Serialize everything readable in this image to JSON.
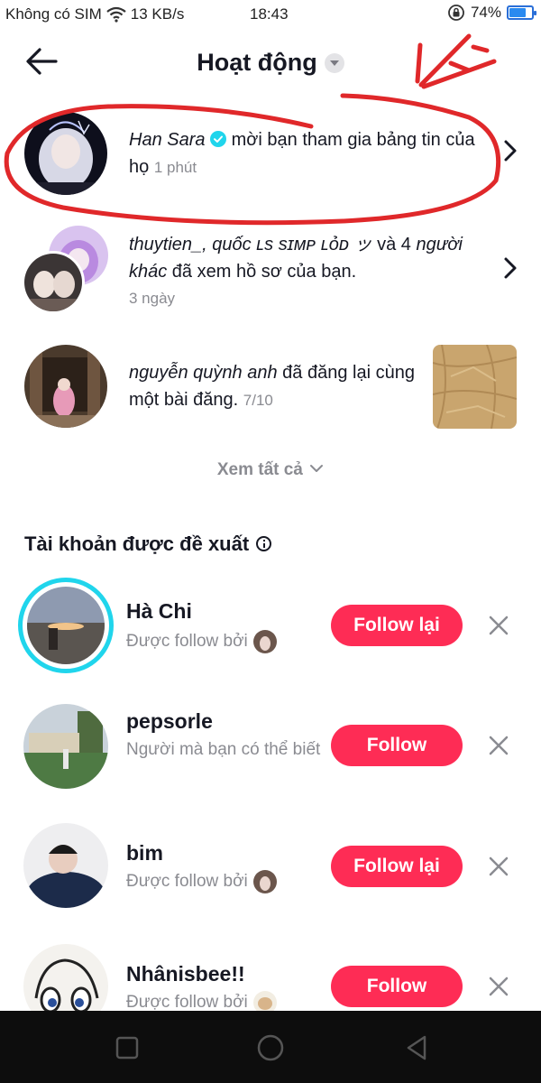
{
  "status_bar": {
    "carrier": "Không có SIM",
    "speed": "13 KB/s",
    "time": "18:43",
    "battery": "74%",
    "battery_level": 0.74
  },
  "header": {
    "title": "Hoạt động"
  },
  "activities": [
    {
      "name": "Han Sara",
      "text": " mời bạn tham gia bảng tin của họ",
      "time": "1 phút",
      "verified": true
    },
    {
      "name": "thuytien_, quốc ʟs sɪᴍᴘ ʟỏᴅ ッ",
      "text_mid": " và 4 ",
      "name2": "người khác",
      "text": " đã xem hồ sơ của bạn.",
      "time": "3 ngày"
    },
    {
      "name": "nguyễn quỳnh anh",
      "text": " đã đăng lại cùng một bài đăng.",
      "time": "7/10"
    }
  ],
  "see_all": "Xem tất cả",
  "suggested": {
    "title": "Tài khoản được đề xuất",
    "items": [
      {
        "name": "Hà Chi",
        "subtitle": "Được follow bởi",
        "button": "Follow lại"
      },
      {
        "name": "pepsorle",
        "subtitle": "Người mà bạn có thể biết",
        "button": "Follow"
      },
      {
        "name": "bim",
        "subtitle": "Được follow bởi",
        "button": "Follow lại"
      },
      {
        "name": "Nhânisbee!!",
        "subtitle": "Được follow bởi",
        "button": "Follow"
      }
    ]
  },
  "colors": {
    "accent": "#fe2c55",
    "verified": "#20d5ec",
    "annotation": "#e0282a"
  }
}
